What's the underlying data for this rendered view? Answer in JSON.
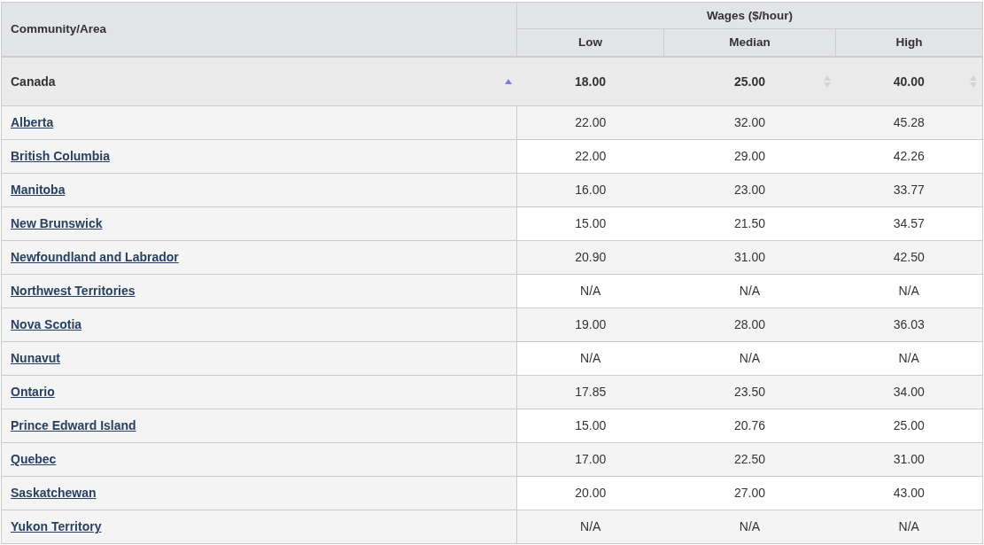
{
  "table": {
    "group_header": "Wages ($/hour)",
    "columns": [
      {
        "label": "Community/Area"
      },
      {
        "label": "Low"
      },
      {
        "label": "Median"
      },
      {
        "label": "High"
      }
    ],
    "summary_row": [
      {
        "text": "Canada",
        "sortable": true,
        "sorted": true
      },
      {
        "text": "18.00",
        "sortable": false
      },
      {
        "text": "25.00",
        "sortable": true,
        "sorted": false
      },
      {
        "text": "40.00",
        "sortable": true,
        "sorted": false
      }
    ],
    "rows": [
      {
        "area": "Alberta",
        "low": "22.00",
        "median": "32.00",
        "high": "45.28"
      },
      {
        "area": "British Columbia",
        "low": "22.00",
        "median": "29.00",
        "high": "42.26"
      },
      {
        "area": "Manitoba",
        "low": "16.00",
        "median": "23.00",
        "high": "33.77"
      },
      {
        "area": "New Brunswick",
        "low": "15.00",
        "median": "21.50",
        "high": "34.57"
      },
      {
        "area": "Newfoundland and Labrador",
        "low": "20.90",
        "median": "31.00",
        "high": "42.50"
      },
      {
        "area": "Northwest Territories",
        "low": "N/A",
        "median": "N/A",
        "high": "N/A"
      },
      {
        "area": "Nova Scotia",
        "low": "19.00",
        "median": "28.00",
        "high": "36.03"
      },
      {
        "area": "Nunavut",
        "low": "N/A",
        "median": "N/A",
        "high": "N/A"
      },
      {
        "area": "Ontario",
        "low": "17.85",
        "median": "23.50",
        "high": "34.00"
      },
      {
        "area": "Prince Edward Island",
        "low": "15.00",
        "median": "20.76",
        "high": "25.00"
      },
      {
        "area": "Quebec",
        "low": "17.00",
        "median": "22.50",
        "high": "31.00"
      },
      {
        "area": "Saskatchewan",
        "low": "20.00",
        "median": "27.00",
        "high": "43.00"
      },
      {
        "area": "Yukon Territory",
        "low": "N/A",
        "median": "N/A",
        "high": "N/A"
      }
    ]
  }
}
